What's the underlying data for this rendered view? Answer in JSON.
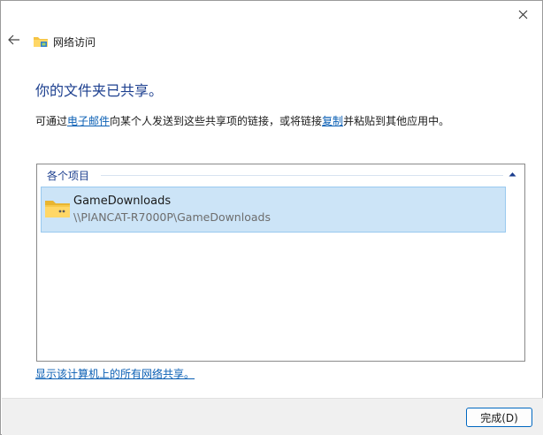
{
  "window": {
    "title": "网络访问",
    "close_glyph": "✕",
    "back_glyph": "←"
  },
  "main": {
    "heading": "你的文件夹已共享。",
    "desc_prefix": "可通过",
    "email_link": "电子邮件",
    "desc_mid": "向某个人发送到这些共享项的链接，或将链接",
    "copy_link": "复制",
    "desc_suffix": "并粘贴到其他应用中。"
  },
  "list": {
    "group_label": "各个项目",
    "items": [
      {
        "name": "GameDownloads",
        "path": "\\\\PIANCAT-R7000P\\GameDownloads"
      }
    ]
  },
  "links": {
    "all_shares": "显示该计算机上的所有网络共享。"
  },
  "footer": {
    "done_label": "完成(D)"
  },
  "colors": {
    "heading": "#1c3f8f",
    "link": "#0a5fb4",
    "selection": "#cce4f7",
    "footer_bg": "#f0f0f0"
  }
}
